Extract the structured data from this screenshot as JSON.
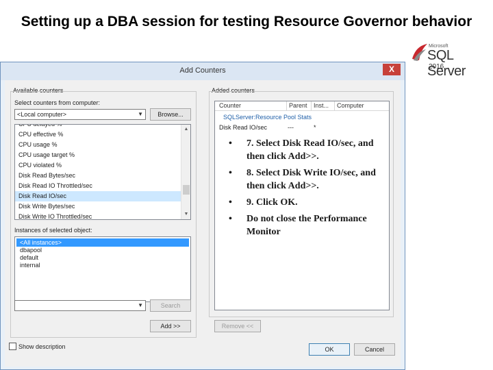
{
  "slide": {
    "title": "Setting up a DBA session for testing Resource Governor behavior"
  },
  "logo": {
    "vendor": "Microsoft",
    "product": "SQL Server",
    "version": "2016"
  },
  "dialog": {
    "title": "Add Counters",
    "close_label": "X",
    "available": {
      "group_label": "Available counters",
      "computer_label": "Select counters from computer:",
      "computer_value": "<Local computer>",
      "browse_label": "Browse...",
      "counters": [
        "CPU delayed %",
        "CPU effective %",
        "CPU usage %",
        "CPU usage target %",
        "CPU violated %",
        "Disk Read Bytes/sec",
        "Disk Read IO Throttled/sec",
        "Disk Read IO/sec",
        "Disk Write Bytes/sec",
        "Disk Write IO Throttled/sec"
      ],
      "instances_label": "Instances of selected object:",
      "instances": [
        "<All instances>",
        "dbapool",
        "default",
        "internal"
      ],
      "search_value": "",
      "search_label": "Search",
      "add_label": "Add >>"
    },
    "added": {
      "group_label": "Added counters",
      "columns": [
        "Counter",
        "Parent",
        "Inst...",
        "Computer"
      ],
      "object_row": "SQLServer:Resource Pool Stats",
      "counter_row": {
        "counter": "Disk Read IO/sec",
        "parent": "---",
        "instance": "*"
      },
      "remove_label": "Remove <<"
    },
    "show_description_label": "Show description",
    "ok_label": "OK",
    "cancel_label": "Cancel"
  },
  "instructions": [
    "7. Select Disk Read IO/sec, and then click Add>>.",
    "8. Select Disk Write IO/sec, and then click Add>>.",
    "9. Click OK.",
    "Do not close the Performance Monitor"
  ],
  "colors": {
    "selection": "#3399ff",
    "titlebar": "#dbe6f3",
    "close": "#c7413a",
    "link": "#1f5fa8"
  }
}
